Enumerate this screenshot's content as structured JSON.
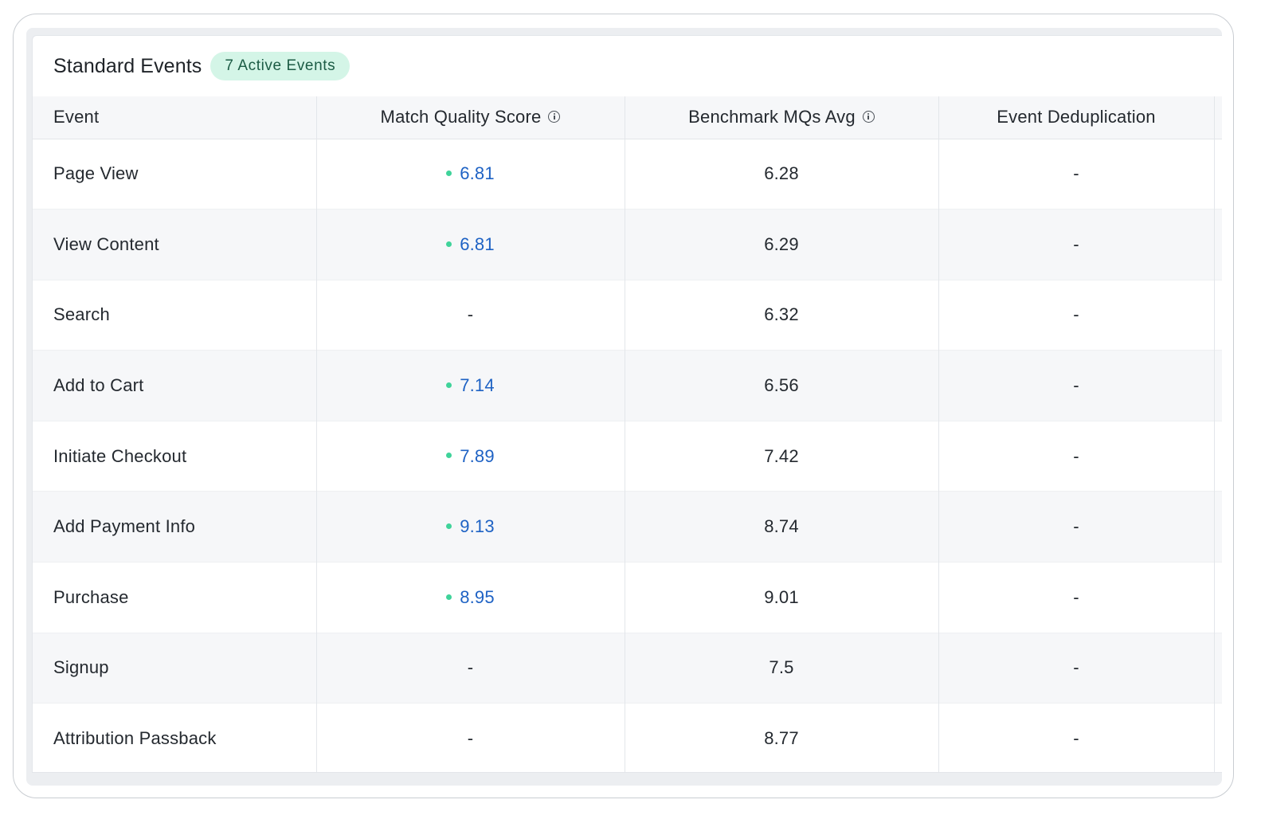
{
  "card": {
    "title": "Standard Events",
    "badge": "7 Active Events"
  },
  "table": {
    "headers": {
      "event": "Event",
      "match_quality": "Match Quality Score",
      "benchmark": "Benchmark MQs Avg",
      "dedup": "Event Deduplication"
    },
    "rows": [
      {
        "event": "Page View",
        "score": "6.81",
        "benchmark": "6.28",
        "dedup": "-"
      },
      {
        "event": "View Content",
        "score": "6.81",
        "benchmark": "6.29",
        "dedup": "-"
      },
      {
        "event": "Search",
        "score": "-",
        "benchmark": "6.32",
        "dedup": "-"
      },
      {
        "event": "Add to Cart",
        "score": "7.14",
        "benchmark": "6.56",
        "dedup": "-"
      },
      {
        "event": "Initiate Checkout",
        "score": "7.89",
        "benchmark": "7.42",
        "dedup": "-"
      },
      {
        "event": "Add Payment Info",
        "score": "9.13",
        "benchmark": "8.74",
        "dedup": "-"
      },
      {
        "event": "Purchase",
        "score": "8.95",
        "benchmark": "9.01",
        "dedup": "-"
      },
      {
        "event": "Signup",
        "score": "-",
        "benchmark": "7.5",
        "dedup": "-"
      },
      {
        "event": "Attribution Passback",
        "score": "-",
        "benchmark": "8.77",
        "dedup": "-"
      }
    ]
  },
  "icons": {
    "info": "info-circle-icon",
    "status_dot": "status-dot-icon"
  },
  "colors": {
    "badge_bg": "#d4f5e7",
    "badge_text": "#1c5c45",
    "score_link": "#1e62c4",
    "status_dot": "#3fd39a",
    "row_alt": "#f6f7f9"
  }
}
